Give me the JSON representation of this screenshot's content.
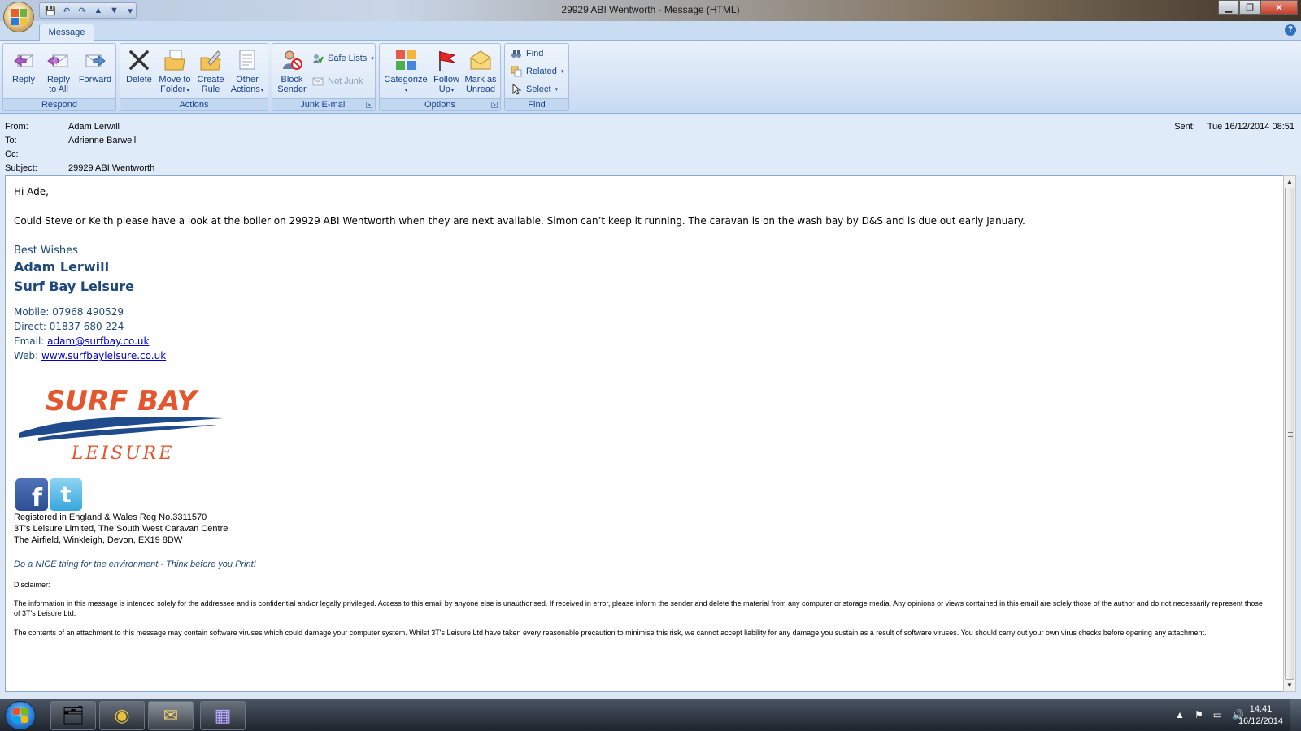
{
  "window": {
    "title": "29929 ABI Wentworth - Message (HTML)",
    "minimize": "▁",
    "maximize": "❐",
    "close": "✕"
  },
  "qat": {
    "save": "💾",
    "undo": "↶",
    "redo": "↷",
    "prev": "▲",
    "next": "▼",
    "customize": "▾"
  },
  "ribbon": {
    "tab": "Message",
    "help": "?",
    "groups": {
      "respond": "Respond",
      "actions": "Actions",
      "junk": "Junk E-mail",
      "options": "Options",
      "find": "Find"
    },
    "buttons": {
      "reply": "Reply",
      "reply_all_1": "Reply",
      "reply_all_2": "to All",
      "forward": "Forward",
      "delete": "Delete",
      "move_1": "Move to",
      "move_2": "Folder",
      "rule_1": "Create",
      "rule_2": "Rule",
      "other_1": "Other",
      "other_2": "Actions",
      "block_1": "Block",
      "block_2": "Sender",
      "safe_lists": "Safe Lists",
      "not_junk": "Not Junk",
      "categorize": "Categorize",
      "follow_1": "Follow",
      "follow_2": "Up",
      "mark_1": "Mark as",
      "mark_2": "Unread",
      "find": "Find",
      "related": "Related",
      "select": "Select"
    }
  },
  "header": {
    "from_label": "From:",
    "from": "Adam Lerwill",
    "to_label": "To:",
    "to": "Adrienne Barwell",
    "cc_label": "Cc:",
    "cc": "",
    "subject_label": "Subject:",
    "subject": "29929 ABI Wentworth",
    "sent_label": "Sent:",
    "sent": "Tue 16/12/2014 08:51"
  },
  "body": {
    "greeting": "Hi Ade,",
    "message": "Could Steve or Keith please have a look at the boiler on 29929 ABI Wentworth when they are next available.  Simon can’t keep it running.  The caravan is on the wash bay by D&S and is due out early January.",
    "signature": {
      "wishes": "Best Wishes",
      "name": "Adam Lerwill",
      "company": "Surf Bay Leisure",
      "mobile": "Mobile: 07968 490529",
      "direct": "Direct:  01837 680 224",
      "email_label": "Email: ",
      "email": "adam@surfbay.co.uk",
      "web_label": "Web: ",
      "web": "www.surfbayleisure.co.uk"
    },
    "logo": {
      "line1": "SURF BAY",
      "line2": "LEISURE"
    },
    "social": {
      "facebook": "f",
      "twitter": "t"
    },
    "registration": [
      "Registered in England & Wales Reg No.3311570",
      "3T's Leisure Limited, The South West Caravan Centre",
      "The Airfield, Winkleigh, Devon, EX19 8DW"
    ],
    "nice": "Do a NICE thing for the environment - Think before you Print!",
    "disclaimer_heading": "Disclaimer:",
    "disclaimer_1": "The information in this message is intended solely for the addressee and is confidential and/or legally privileged. Access to this email by anyone else is unauthorised. If received in error, please inform the sender and delete the material from any computer or storage media. Any opinions or views contained in this email are solely those of the author and do not necessarily represent those of 3T's Leisure Ltd.",
    "disclaimer_2": "The contents of an attachment to this message may contain software viruses which could damage your computer system. Whilst 3T's Leisure Ltd have taken every reasonable precaution to minimise this risk, we cannot accept liability for any damage you sustain as a result of software viruses. You should carry out your own virus checks before opening any attachment."
  },
  "taskbar": {
    "apps": [
      "🗂",
      "◉",
      "✉",
      "▦"
    ],
    "tray": [
      "▲",
      "⚑",
      "▭",
      "🔊"
    ],
    "time": "14:41",
    "date": "16/12/2014"
  },
  "colors": {
    "signature_blue": "#1f497d",
    "logo_orange": "#e4572e",
    "logo_blue": "#1f4a8c"
  }
}
